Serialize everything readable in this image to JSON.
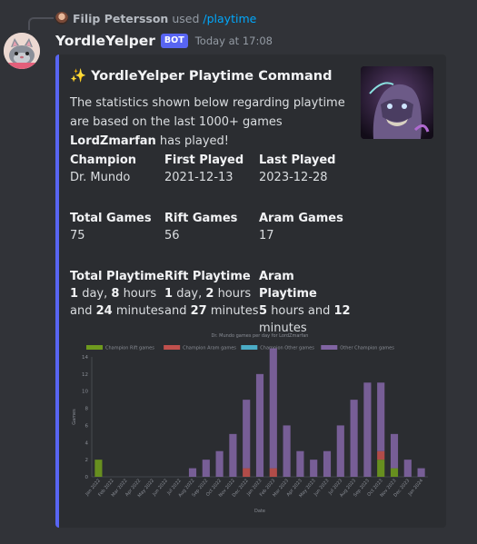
{
  "reply": {
    "user": "Filip Petersson",
    "used": "used",
    "command": "/playtime"
  },
  "message": {
    "username": "YordleYelper",
    "bot_tag": "BOT",
    "timestamp": "Today at 17:08"
  },
  "embed": {
    "accent_color": "#5865f2",
    "title_icon": "sparkles-emoji",
    "title": "YordleYelper Playtime Command",
    "desc_pre": "The statistics shown below regarding playtime are based on the last 1000+ games ",
    "desc_user": "LordZmarfan",
    "desc_post": " has played!",
    "fields": {
      "champion": {
        "name": "Champion",
        "value": "Dr. Mundo"
      },
      "first_played": {
        "name": "First Played",
        "value": "2021-12-13"
      },
      "last_played": {
        "name": "Last Played",
        "value": "2023-12-28"
      },
      "total_games": {
        "name": "Total Games",
        "value": "75"
      },
      "rift_games": {
        "name": "Rift Games",
        "value": "56"
      },
      "aram_games": {
        "name": "Aram Games",
        "value": "17"
      },
      "total_playtime": {
        "name": "Total Playtime",
        "days": "1",
        "hours": "8",
        "minutes": "24"
      },
      "rift_playtime": {
        "name": "Rift Playtime",
        "days": "1",
        "hours": "2",
        "minutes": "27"
      },
      "aram_playtime": {
        "name": "Aram Playtime",
        "hours": "5",
        "minutes": "12"
      }
    },
    "units": {
      "day": "day,",
      "hours": "hours",
      "and": "and",
      "minutes": "minutes"
    }
  },
  "chart_data": {
    "type": "bar",
    "stacked": true,
    "title": "Dr. Mundo games per day for LordZmarfan",
    "xlabel": "Date",
    "ylabel": "Games",
    "ylim": [
      0,
      14
    ],
    "yticks": [
      0,
      2,
      4,
      6,
      8,
      10,
      12,
      14
    ],
    "grid": false,
    "legend_position": "top",
    "categories": [
      "Jan 2022",
      "Feb 2022",
      "Mar 2022",
      "Apr 2022",
      "May 2022",
      "Jun 2022",
      "Jul 2022",
      "Aug 2022",
      "Sep 2022",
      "Oct 2022",
      "Nov 2022",
      "Dec 2022",
      "Jan 2023",
      "Feb 2023",
      "Mar 2023",
      "Apr 2023",
      "May 2023",
      "Jun 2023",
      "Jul 2023",
      "Aug 2023",
      "Sep 2023",
      "Oct 2023",
      "Nov 2023",
      "Dec 2023",
      "Jan 2024"
    ],
    "series": [
      {
        "name": "Champion Rift games",
        "color": "#6e9a1e",
        "values": [
          2,
          0,
          0,
          0,
          0,
          0,
          0,
          0,
          0,
          0,
          0,
          0,
          0,
          0,
          0,
          0,
          0,
          0,
          0,
          0,
          0,
          2,
          1,
          0,
          0
        ]
      },
      {
        "name": "Champion Aram games",
        "color": "#c0504d",
        "values": [
          0,
          0,
          0,
          0,
          0,
          0,
          0,
          0,
          0,
          0,
          0,
          1,
          0,
          1,
          0,
          0,
          0,
          0,
          0,
          0,
          0,
          1,
          0,
          0,
          0
        ]
      },
      {
        "name": "Champion Other games",
        "color": "#4bacc6",
        "values": [
          0,
          0,
          0,
          0,
          0,
          0,
          0,
          0,
          0,
          0,
          0,
          0,
          0,
          0,
          0,
          0,
          0,
          0,
          0,
          0,
          0,
          0,
          0,
          0,
          0
        ]
      },
      {
        "name": "Other Champion games",
        "color": "#8064a2",
        "values": [
          0,
          0,
          0,
          0,
          0,
          0,
          0,
          1,
          2,
          3,
          5,
          8,
          12,
          14,
          6,
          3,
          2,
          3,
          6,
          9,
          11,
          8,
          4,
          2,
          1
        ]
      }
    ]
  }
}
